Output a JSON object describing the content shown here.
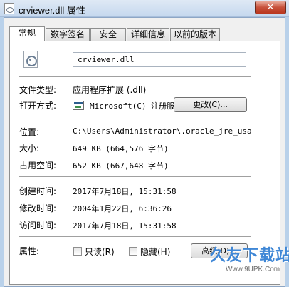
{
  "window": {
    "title": "crviewer.dll 属性",
    "close_glyph": "✕"
  },
  "tabs": [
    {
      "label": "常规"
    },
    {
      "label": "数字签名"
    },
    {
      "label": "安全"
    },
    {
      "label": "详细信息"
    },
    {
      "label": "以前的版本"
    }
  ],
  "general": {
    "file_name": "crviewer.dll",
    "file_type_label": "文件类型:",
    "file_type_value": "应用程序扩展 (.dll)",
    "opens_with_label": "打开方式:",
    "opens_with_value": "Microsoft(C) 注册服",
    "change_button": "更改(C)...",
    "location_label": "位置:",
    "location_value": "C:\\Users\\Administrator\\.oracle_jre_usage\\",
    "size_label": "大小:",
    "size_value": "649 KB (664,576 字节)",
    "size_on_disk_label": "占用空间:",
    "size_on_disk_value": "652 KB (667,648 字节)",
    "created_label": "创建时间:",
    "created_value": "2017年7月18日, 15:31:58",
    "modified_label": "修改时间:",
    "modified_value": "2004年1月22日, 6:36:26",
    "accessed_label": "访问时间:",
    "accessed_value": "2017年7月18日, 15:31:58",
    "attributes_label": "属性:",
    "readonly_label": "只读(R)",
    "hidden_label": "隐藏(H)",
    "advanced_button": "高级(D)..."
  },
  "watermark": {
    "text": "久友下载站",
    "url": "Www.9UPK.Com"
  }
}
